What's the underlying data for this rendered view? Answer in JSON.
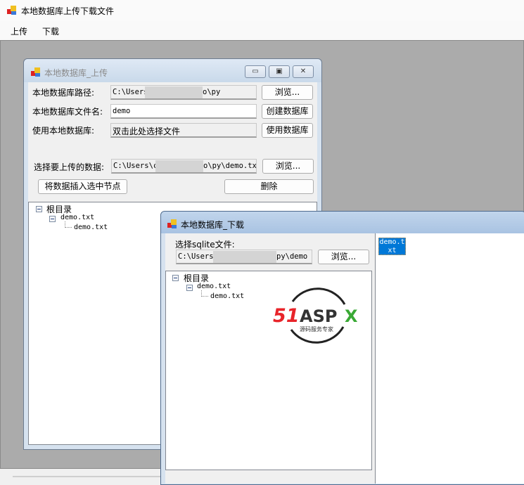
{
  "app": {
    "title": "本地数据库上传下载文件",
    "menu": [
      "上传",
      "下载"
    ]
  },
  "upload_window": {
    "title": "本地数据库_上传",
    "controls": {
      "minimize": "▭",
      "maximize": "▣",
      "close": "✕"
    },
    "db_path_label": "本地数据库路径:",
    "db_path_value": "C:\\Users",
    "db_path_suffix": "o\\py",
    "browse1": "浏览...",
    "db_name_label": "本地数据库文件名:",
    "db_name_value": "demo",
    "create_db": "创建数据库",
    "use_db_label": "使用本地数据库:",
    "use_db_value": "双击此处选择文件",
    "use_db": "使用数据库",
    "upload_data_label": "选择要上传的数据:",
    "upload_data_value": "C:\\Users\\c",
    "upload_data_suffix": "o\\py\\demo.txt",
    "browse2": "浏览...",
    "insert_btn": "将数据插入选中节点",
    "delete_btn": "删除",
    "tree": {
      "root": "根目录",
      "child": "demo.txt",
      "grandchild": "demo.txt"
    }
  },
  "download_window": {
    "title": "本地数据库_下载",
    "sqlite_label": "选择sqlite文件:",
    "sqlite_value": "C:\\Users'",
    "sqlite_suffix": "py\\demo",
    "browse": "浏览...",
    "tree": {
      "root": "根目录",
      "child": "demo.txt",
      "grandchild": "demo.txt"
    },
    "list_items": [
      "demo.t xt"
    ],
    "watermark": {
      "brand": "51Aspx",
      "tagline": "源码服务专家"
    }
  },
  "colors": {
    "mdi_bg": "#ababab",
    "selection": "#0078d7",
    "logo_red": "#e8242a",
    "logo_green": "#3aa935"
  }
}
